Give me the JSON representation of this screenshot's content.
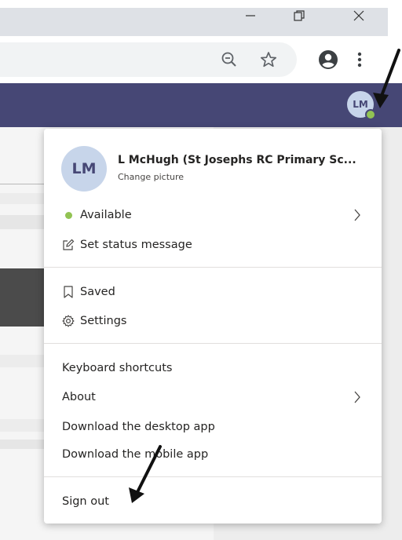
{
  "window_controls": [
    "minimize",
    "restore",
    "close"
  ],
  "browser_toolbar": {
    "icons": [
      "zoom-out-icon",
      "star-icon",
      "profile-icon",
      "menu-icon"
    ]
  },
  "teams": {
    "avatar_initials": "LM",
    "status_color": "#92c353",
    "brand_color": "#464775"
  },
  "profile_menu": {
    "initials": "LM",
    "name": "L McHugh (St Josephs RC Primary Sc...",
    "change_picture": "Change picture",
    "status": "Available",
    "set_status_message": "Set status message",
    "saved": "Saved",
    "settings": "Settings",
    "keyboard_shortcuts": "Keyboard shortcuts",
    "about": "About",
    "download_desktop": "Download the desktop app",
    "download_mobile": "Download the mobile app",
    "sign_out": "Sign out"
  }
}
